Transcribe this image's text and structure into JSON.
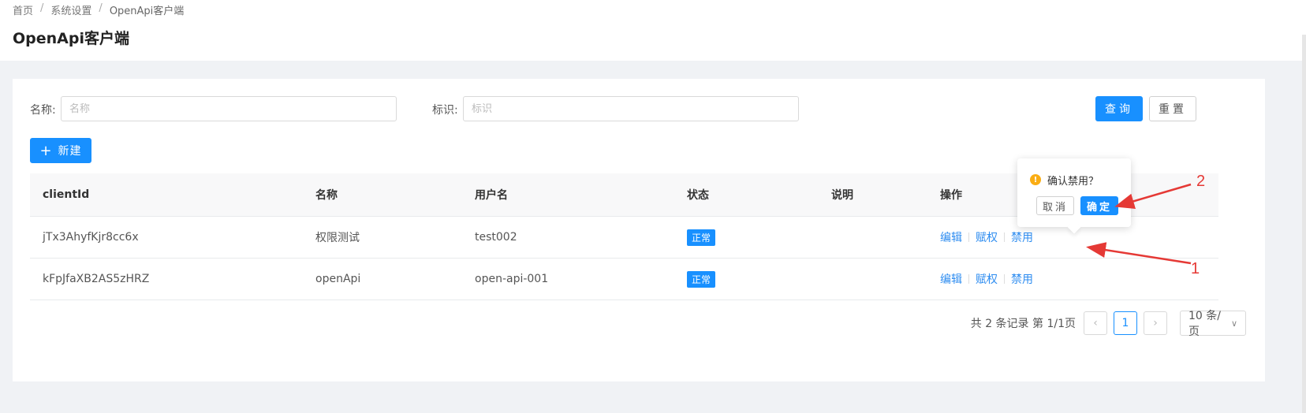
{
  "breadcrumb": {
    "home": "首页",
    "sep": "/",
    "settings": "系统设置",
    "current": "OpenApi客户端"
  },
  "page_title": "OpenApi客户端",
  "filters": {
    "name_label": "名称:",
    "name_placeholder": "名称",
    "id_label": "标识:",
    "id_placeholder": "标识"
  },
  "buttons": {
    "query": "查询",
    "reset": "重置",
    "new": "新建",
    "new_icon": "plus-icon"
  },
  "table": {
    "columns": [
      "clientId",
      "名称",
      "用户名",
      "状态",
      "说明",
      "操作"
    ],
    "rows": [
      {
        "clientId": "jTx3AhyfKjr8cc6x",
        "name": "权限测试",
        "username": "test002",
        "status": "正常",
        "desc": "",
        "ops": [
          "编辑",
          "赋权",
          "禁用"
        ]
      },
      {
        "clientId": "kFpJfaXB2AS5zHRZ",
        "name": "openApi",
        "username": "open-api-001",
        "status": "正常",
        "desc": "",
        "ops": [
          "编辑",
          "赋权",
          "禁用"
        ]
      }
    ]
  },
  "pagination": {
    "total_text": "共 2 条记录 第 1/1页",
    "current_page": "1",
    "page_size": "10 条/页",
    "prev_icon": "chevron-left-icon",
    "next_icon": "chevron-right-icon"
  },
  "popconfirm": {
    "icon": "warning-icon",
    "message": "确认禁用？",
    "cancel": "取消",
    "ok": "确定"
  },
  "annotations": {
    "one": "1",
    "two": "2"
  },
  "colors": {
    "primary": "#1890ff",
    "link": "#2d8cf0",
    "annotation": "#e53935",
    "warning": "#faad14"
  }
}
